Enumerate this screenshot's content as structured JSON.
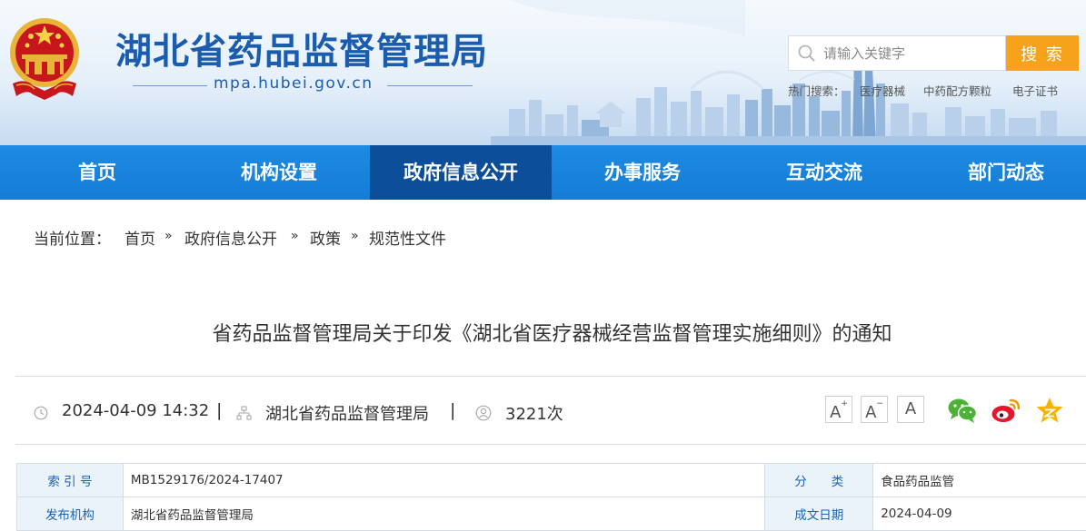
{
  "header": {
    "site_title": "湖北省药品监督管理局",
    "site_domain": "mpa.hubei.gov.cn",
    "search": {
      "placeholder": "请输入关键字",
      "button_label": "搜 索"
    },
    "hot_search": {
      "label": "热门搜索：",
      "items": [
        "医疗器械",
        "中药配方颗粒",
        "电子证书"
      ]
    },
    "colors": {
      "brand_blue": "#1a5cad",
      "search_orange": "#f7a21b"
    }
  },
  "nav": {
    "items": [
      {
        "label": "首页"
      },
      {
        "label": "机构设置"
      },
      {
        "label": "政府信息公开",
        "active": true
      },
      {
        "label": "办事服务"
      },
      {
        "label": "互动交流"
      },
      {
        "label": "部门动态"
      }
    ],
    "colors": {
      "bar": "#157cd6",
      "active": "#0d4e9a"
    }
  },
  "breadcrumb": {
    "label": "当前位置：",
    "items": [
      "首页",
      "政府信息公开",
      "政策",
      "规范性文件"
    ],
    "separator": "»"
  },
  "article": {
    "title": "省药品监督管理局关于印发《湖北省医疗器械经营监督管理实施细则》的通知",
    "date": "2024-04-09 14:32",
    "source": "湖北省药品监督管理局",
    "views": "3221次",
    "font_buttons": [
      "A",
      "A",
      "A"
    ],
    "share_icons": [
      "wechat-icon",
      "weibo-icon",
      "qzone-icon"
    ]
  },
  "info_table": {
    "rows": [
      {
        "label1": "索 引 号",
        "value1": "MB1529176/2024-17407",
        "label2": "分　　类",
        "value2": "食品药品监管"
      },
      {
        "label1": "发布机构",
        "value1": "湖北省药品监督管理局",
        "label2": "成文日期",
        "value2": "2024-04-09"
      }
    ]
  }
}
